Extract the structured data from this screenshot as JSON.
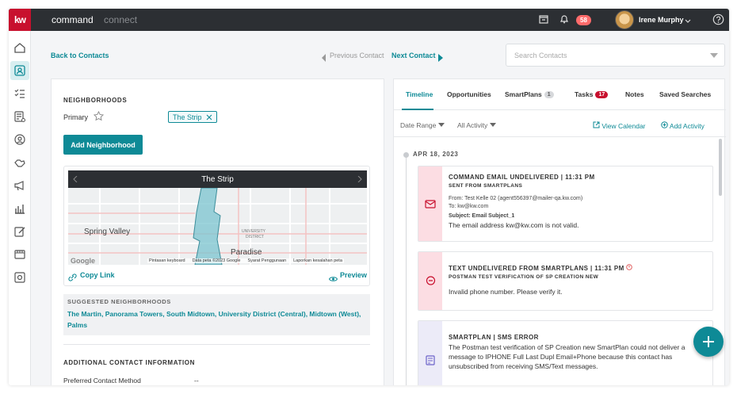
{
  "brand": {
    "logo": "kw",
    "command": "command",
    "connect": "connect"
  },
  "header": {
    "notifications_count": "58",
    "user_name": "Irene Murphy"
  },
  "nav": {
    "back": "Back to Contacts",
    "previous": "Previous Contact",
    "next": "Next Contact",
    "search_placeholder": "Search Contacts"
  },
  "neighborhoods": {
    "title": "NEIGHBORHOODS",
    "primary_label": "Primary",
    "chip": "The Strip",
    "add_button": "Add Neighborhood",
    "map": {
      "header": "The Strip",
      "labels": {
        "spring_valley": "Spring Valley",
        "paradise": "Paradise",
        "university": "UNIVERSITY",
        "district": "DISTRICT",
        "google": "Google"
      },
      "footer": [
        "Pintasan keyboard",
        "Data peta ©2023 Google",
        "Syarat Penggunaan",
        "Laporkan kesalahan peta"
      ]
    },
    "copy_link": "Copy Link",
    "preview": "Preview",
    "suggested_title": "SUGGESTED NEIGHBORHOODS",
    "suggested_list": "The Martin, Panorama Towers, South Midtown, University District (Central), Midtown (West), Palms"
  },
  "additional": {
    "title": "ADDITIONAL CONTACT INFORMATION",
    "preferred_label": "Preferred Contact Method",
    "preferred_value": "--"
  },
  "tabs": [
    {
      "label": "Timeline"
    },
    {
      "label": "Opportunities"
    },
    {
      "label": "SmartPlans",
      "badge": "1"
    },
    {
      "label": "Tasks",
      "badge": "17"
    },
    {
      "label": "Notes"
    },
    {
      "label": "Saved Searches"
    }
  ],
  "filters": {
    "date_range": "Date Range",
    "all_activity": "All Activity",
    "view_calendar": "View Calendar",
    "add_activity": "Add Activity"
  },
  "timeline": {
    "date": "APR 18, 2023",
    "events": [
      {
        "title": "COMMAND EMAIL UNDELIVERED | 11:31 PM",
        "subtitle": "SENT FROM SMARTPLANS",
        "from": "From: Test Kelle 02 (agent556397@mailer-qa.kw.com)",
        "to": "To: kw@kw.com",
        "subject": "Subject: Email Subject_1",
        "text": "The email address kw@kw.com is not valid."
      },
      {
        "title": "TEXT UNDELIVERED FROM SMARTPLANS | 11:31 PM",
        "subtitle": "POSTMAN TEST VERIFICATION OF SP CREATION NEW",
        "text": "Invalid phone number. Please verify it."
      },
      {
        "title": "SMARTPLAN | SMS ERROR",
        "text": "The Postman test verification of SP Creation new SmartPlan could not deliver a message to IPHONE Full Last Dupl Email+Phone because this contact has unsubscribed from receiving SMS/Text messages."
      }
    ]
  },
  "colors": {
    "accent": "#0e8a96",
    "topbar": "#2c2f33",
    "brand_red": "#c8102e",
    "error_strip": "#fcdde3",
    "info_strip": "#ecebf8"
  }
}
